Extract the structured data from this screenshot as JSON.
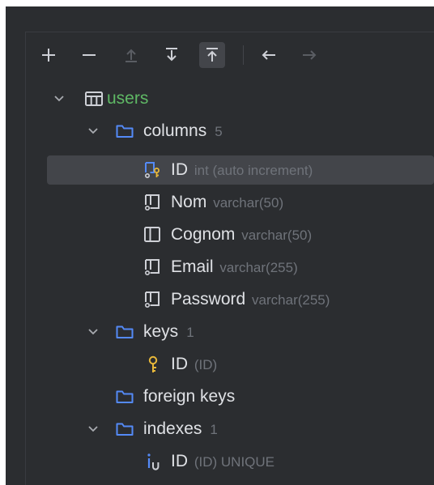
{
  "toolbar": {
    "add": "add-icon",
    "remove": "remove-icon",
    "move_up": "move-up-icon",
    "move_down": "move-down-icon",
    "pin": "pin-top-icon",
    "back": "arrow-left-icon",
    "forward": "arrow-right-icon"
  },
  "tree": {
    "table": {
      "name": "users"
    },
    "columns": {
      "label": "columns",
      "count": "5",
      "items": [
        {
          "name": "ID",
          "type": "int (auto increment)"
        },
        {
          "name": "Nom",
          "type": "varchar(50)"
        },
        {
          "name": "Cognom",
          "type": "varchar(50)"
        },
        {
          "name": "Email",
          "type": "varchar(255)"
        },
        {
          "name": "Password",
          "type": "varchar(255)"
        }
      ]
    },
    "keys": {
      "label": "keys",
      "count": "1",
      "items": [
        {
          "name": "ID",
          "detail": "(ID)"
        }
      ]
    },
    "foreign_keys": {
      "label": "foreign keys"
    },
    "indexes": {
      "label": "indexes",
      "count": "1",
      "items": [
        {
          "name": "ID",
          "detail": "(ID) UNIQUE"
        }
      ]
    }
  },
  "colors": {
    "background": "#2b2d30",
    "selection": "#43454a",
    "folder": "#548af7",
    "key": "#e8b83a",
    "table_name": "#5fb865",
    "muted_text": "#6f737a",
    "text": "#dfe1e5"
  }
}
